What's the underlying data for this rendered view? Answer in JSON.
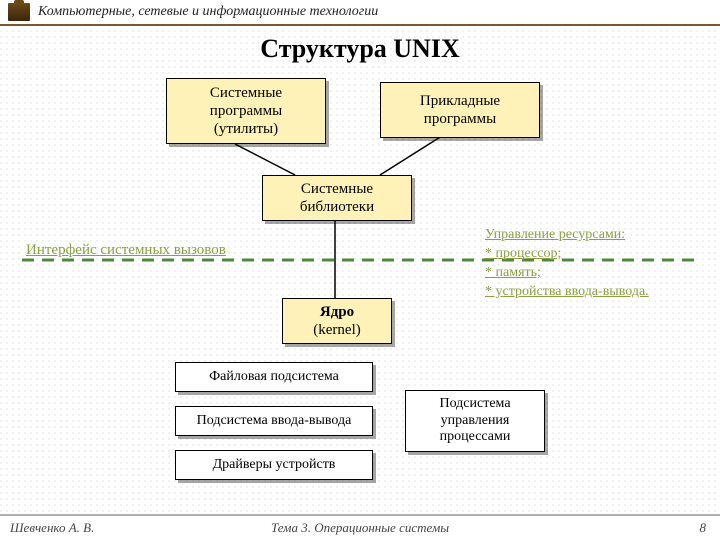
{
  "header": {
    "course": "Компьютерные, сетевые и информационные технологии"
  },
  "title": "Структура UNIX",
  "boxes": {
    "sys_utils": {
      "l1": "Системные",
      "l2": "программы",
      "l3": "(утилиты)"
    },
    "apps": {
      "l1": "Прикладные",
      "l2": "программы"
    },
    "libs": {
      "l1": "Системные",
      "l2": "библиотеки"
    },
    "kernel": {
      "l1": "Ядро",
      "l2": "(kernel)"
    },
    "fs": {
      "l1": "Файловая подсистема"
    },
    "io": {
      "l1": "Подсистема ввода-вывода"
    },
    "proc": {
      "l1": "Подсистема",
      "l2": "управления",
      "l3": "процессами"
    },
    "drv": {
      "l1": "Драйверы устройств"
    }
  },
  "labels": {
    "iface": "Интерфейс системных вызовов",
    "note": "Управление ресурсами:\n* процессор;\n* память;\n* устройства ввода-вывода."
  },
  "footer": {
    "author": "Шевченко А. В.",
    "topic": "Тема 3. Операционные системы",
    "page": "8"
  }
}
